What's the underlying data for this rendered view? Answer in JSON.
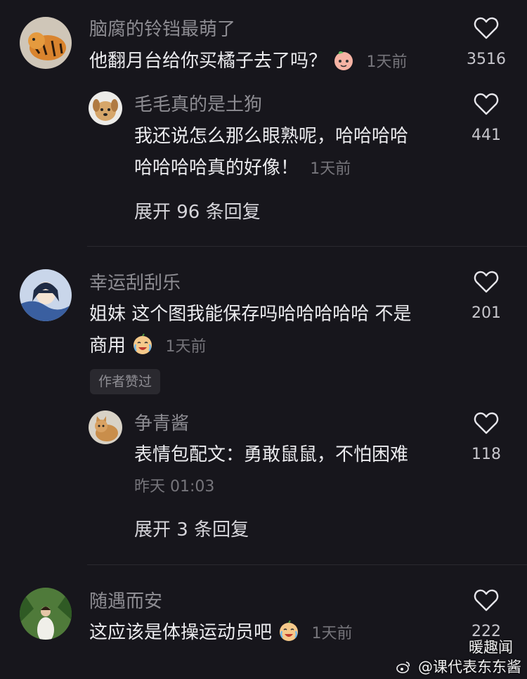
{
  "comments": [
    {
      "username": "脑腐的铃铛最萌了",
      "text_line1": "他翻月台给你买橘子去了吗？",
      "emoji": "peach-emoji",
      "time": "1天前",
      "likes": "3516"
    },
    {
      "username": "毛毛真的是土狗",
      "text_line1": "我还说怎么那么眼熟呢，哈哈哈哈",
      "text_line2": "哈哈哈哈真的好像！",
      "time": "1天前",
      "likes": "441",
      "expand": "展开 96 条回复"
    },
    {
      "username": "幸运刮刮乐",
      "text_line1": "姐妹 这个图我能保存吗哈哈哈哈哈 不是",
      "text_line2": "商用",
      "emoji": "laughing-crying-emoji",
      "time": "1天前",
      "likes": "201",
      "badge": "作者赞过"
    },
    {
      "username": "争青酱",
      "text_line1": "表情包配文：勇敢鼠鼠，不怕困难",
      "time": "昨天 01:03",
      "likes": "118",
      "expand": "展开 3 条回复"
    },
    {
      "username": "随遇而安",
      "text_line1": "这应该是体操运动员吧",
      "emoji": "laughing-crying-emoji",
      "time": "1天前",
      "likes": "222"
    }
  ],
  "watermark": {
    "top": "暖趣闻",
    "bottom": "@课代表东东酱"
  },
  "colors": {
    "background": "#17161c",
    "username": "#8e8d93",
    "text": "#ebebee",
    "time": "#76757b"
  }
}
